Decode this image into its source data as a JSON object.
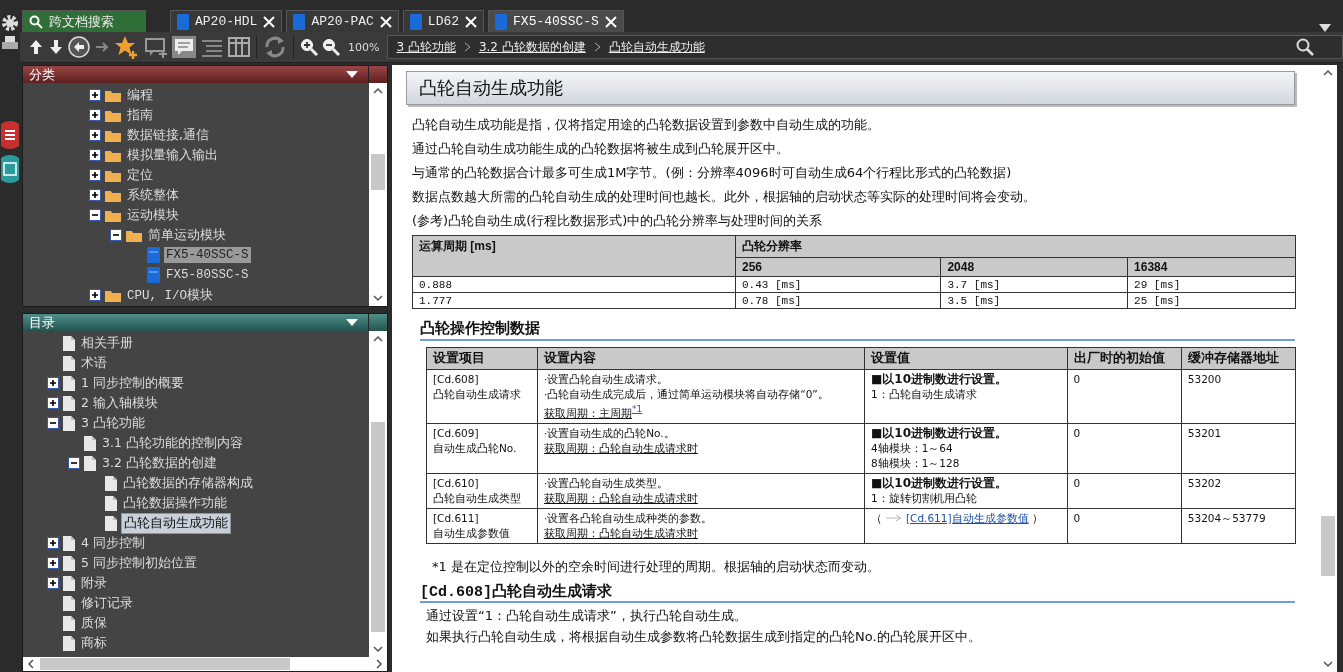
{
  "tabs": [
    {
      "kind": "search",
      "label": "跨文档搜索",
      "selected": false
    },
    {
      "kind": "doc",
      "label": "AP20-HDL",
      "selected": false
    },
    {
      "kind": "doc",
      "label": "AP20-PAC",
      "selected": false
    },
    {
      "kind": "doc",
      "label": "LD62",
      "selected": false
    },
    {
      "kind": "doc",
      "label": "FX5-40SSC-S",
      "selected": true
    }
  ],
  "toolbar": {
    "zoom": "100%",
    "breadcrumb": [
      "3 凸轮功能",
      "3.2 凸轮数据的创建",
      "凸轮自动生成功能"
    ]
  },
  "category_panel": {
    "title": "分类",
    "items": [
      {
        "label": "编程",
        "kind": "folder",
        "expanded": false,
        "selected": false
      },
      {
        "label": "指南",
        "kind": "folder",
        "expanded": false,
        "selected": false
      },
      {
        "label": "数据链接,通信",
        "kind": "folder",
        "expanded": false,
        "selected": false
      },
      {
        "label": "模拟量输入输出",
        "kind": "folder",
        "expanded": false,
        "selected": false
      },
      {
        "label": "定位",
        "kind": "folder",
        "expanded": false,
        "selected": false
      },
      {
        "label": "系统整体",
        "kind": "folder",
        "expanded": false,
        "selected": false
      },
      {
        "label": "运动模块",
        "kind": "folder",
        "expanded": true,
        "selected": false,
        "children": [
          {
            "label": "简单运动模块",
            "kind": "folder",
            "expanded": true,
            "selected": false,
            "children": [
              {
                "label": "FX5-40SSC-S",
                "kind": "book",
                "selected": true
              },
              {
                "label": "FX5-80SSC-S",
                "kind": "book",
                "selected": false
              }
            ]
          }
        ]
      },
      {
        "label": "CPU, I/O模块",
        "kind": "folder",
        "expanded": false,
        "selected": false
      }
    ]
  },
  "contents_panel": {
    "title": "目录",
    "items": [
      {
        "label": "相关手册",
        "kind": "page",
        "selected": false
      },
      {
        "label": "术语",
        "kind": "page",
        "selected": false
      },
      {
        "label": "1 同步控制的概要",
        "kind": "page",
        "expanded": false,
        "selected": false
      },
      {
        "label": "2 输入轴模块",
        "kind": "page",
        "expanded": false,
        "selected": false
      },
      {
        "label": "3 凸轮功能",
        "kind": "page",
        "expanded": true,
        "selected": false,
        "children": [
          {
            "label": "3.1 凸轮功能的控制内容",
            "kind": "page",
            "selected": false
          },
          {
            "label": "3.2 凸轮数据的创建",
            "kind": "page",
            "expanded": true,
            "selected": false,
            "children": [
              {
                "label": "凸轮数据的存储器构成",
                "kind": "page",
                "selected": false
              },
              {
                "label": "凸轮数据操作功能",
                "kind": "page",
                "selected": false
              },
              {
                "label": "凸轮自动生成功能",
                "kind": "page",
                "selected": true
              }
            ]
          }
        ]
      },
      {
        "label": "4 同步控制",
        "kind": "page",
        "expanded": false,
        "selected": false
      },
      {
        "label": "5 同步控制初始位置",
        "kind": "page",
        "expanded": false,
        "selected": false
      },
      {
        "label": "附录",
        "kind": "page",
        "expanded": false,
        "selected": false
      },
      {
        "label": "修订记录",
        "kind": "page",
        "selected": false
      },
      {
        "label": "质保",
        "kind": "page",
        "selected": false
      },
      {
        "label": "商标",
        "kind": "page",
        "selected": false
      }
    ]
  },
  "article": {
    "title": "凸轮自动生成功能",
    "paragraphs": [
      "凸轮自动生成功能是指，仅将指定用途的凸轮数据设置到参数中自动生成的功能。",
      "通过凸轮自动生成功能生成的凸轮数据将被生成到凸轮展开区中。",
      "与通常的凸轮数据合计最多可生成1M字节。(例：分辨率4096时可自动生成64个行程比形式的凸轮数据)",
      "数据点数越大所需的凸轮自动生成的处理时间也越长。此外，根据轴的启动状态等实际的处理时间将会变动。",
      "(参考)凸轮自动生成(行程比数据形式)中的凸轮分辨率与处理时间的关系"
    ],
    "timing_table": {
      "row_header": "运算周期 [ms]",
      "group_header": "凸轮分辨率",
      "columns": [
        "",
        "256",
        "2048",
        "16384"
      ],
      "rows": [
        [
          "0.888",
          "0.43 [ms]",
          "3.7 [ms]",
          "29 [ms]"
        ],
        [
          "1.777",
          "0.78 [ms]",
          "3.5 [ms]",
          "25 [ms]"
        ]
      ]
    },
    "section_title": "凸轮操作控制数据",
    "data_table": {
      "columns": [
        "设置项目",
        "设置内容",
        "设置值",
        "出厂时的初始值",
        "缓冲存储器地址"
      ],
      "rows": [
        {
          "item": [
            "[Cd.608]",
            "凸轮自动生成请求"
          ],
          "content": [
            "·设置凸轮自动生成请求。",
            "·凸轮自动生成完成后，通过简单运动模块将自动存储“0”。"
          ],
          "cycle": "获取周期：主周期",
          "cycle_note": "*1",
          "setting_title": "■以10进制数进行设置。",
          "setting": [
            "1：凸轮自动生成请求"
          ],
          "default": "0",
          "address": "53200"
        },
        {
          "item": [
            "[Cd.609]",
            "自动生成凸轮No."
          ],
          "content": [
            "·设置自动生成的凸轮No.。"
          ],
          "cycle": "获取周期：凸轮自动生成请求时",
          "setting_title": "■以10进制数进行设置。",
          "setting": [
            "4轴模块：1～64",
            "8轴模块：1～128"
          ],
          "default": "0",
          "address": "53201"
        },
        {
          "item": [
            "[Cd.610]",
            "凸轮自动生成类型"
          ],
          "content": [
            "·设置凸轮自动生成类型。"
          ],
          "cycle": "获取周期：凸轮自动生成请求时",
          "setting_title": "■以10进制数进行设置。",
          "setting": [
            "1：旋转切割机用凸轮"
          ],
          "default": "0",
          "address": "53202"
        },
        {
          "item": [
            "[Cd.611]",
            "自动生成参数值"
          ],
          "content": [
            "·设置各凸轮自动生成种类的参数。"
          ],
          "cycle": "获取周期：凸轮自动生成请求时",
          "setting_ref": {
            "open": "（",
            "link": "[Cd.611]自动生成参数值",
            "close": "）"
          },
          "default": "0",
          "address": "53204～53779"
        }
      ]
    },
    "footnote": "*1 是在定位控制以外的空余时间进行处理的周期。根据轴的启动状态而变动。",
    "subsection_title": "[Cd.608]凸轮自动生成请求",
    "sub_paragraphs": [
      "通过设置“1：凸轮自动生成请求”，执行凸轮自动生成。",
      "如果执行凸轮自动生成，将根据自动生成参数将凸轮数据生成到指定的凸轮No.的凸轮展开区中。"
    ]
  }
}
